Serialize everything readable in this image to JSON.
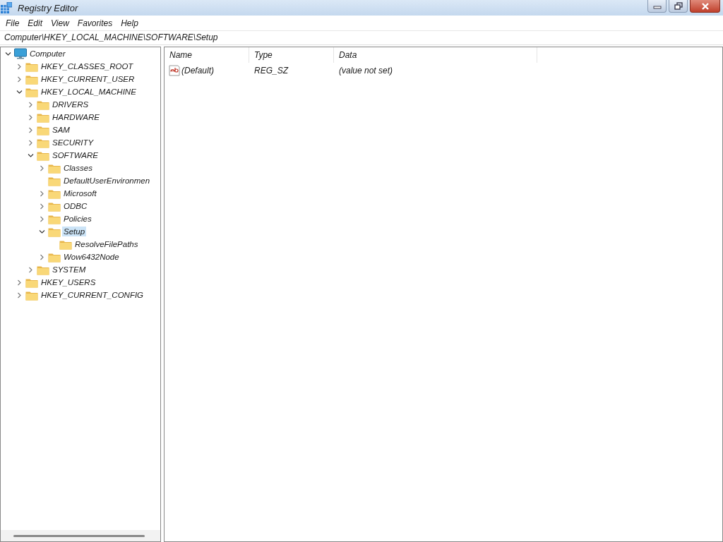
{
  "window": {
    "title": "Registry Editor"
  },
  "menu": [
    "File",
    "Edit",
    "View",
    "Favorites",
    "Help"
  ],
  "address": "Computer\\HKEY_LOCAL_MACHINE\\SOFTWARE\\Setup",
  "tree": [
    {
      "label": "Computer",
      "kind": "computer",
      "expanded": true,
      "selected": false,
      "children": [
        {
          "label": "HKEY_CLASSES_ROOT",
          "kind": "folder",
          "expanded": false,
          "selected": false
        },
        {
          "label": "HKEY_CURRENT_USER",
          "kind": "folder",
          "expanded": false,
          "selected": false
        },
        {
          "label": "HKEY_LOCAL_MACHINE",
          "kind": "folder",
          "expanded": true,
          "selected": false,
          "children": [
            {
              "label": "DRIVERS",
              "kind": "folder",
              "expanded": false,
              "selected": false
            },
            {
              "label": "HARDWARE",
              "kind": "folder",
              "expanded": false,
              "selected": false
            },
            {
              "label": "SAM",
              "kind": "folder",
              "expanded": false,
              "selected": false
            },
            {
              "label": "SECURITY",
              "kind": "folder",
              "expanded": false,
              "selected": false
            },
            {
              "label": "SOFTWARE",
              "kind": "folder",
              "expanded": true,
              "selected": false,
              "children": [
                {
                  "label": "Classes",
                  "kind": "folder",
                  "expanded": false,
                  "selected": false
                },
                {
                  "label": "DefaultUserEnvironmen",
                  "kind": "folder",
                  "selected": false
                },
                {
                  "label": "Microsoft",
                  "kind": "folder",
                  "expanded": false,
                  "selected": false
                },
                {
                  "label": "ODBC",
                  "kind": "folder",
                  "expanded": false,
                  "selected": false
                },
                {
                  "label": "Policies",
                  "kind": "folder",
                  "expanded": false,
                  "selected": false
                },
                {
                  "label": "Setup",
                  "kind": "folder",
                  "expanded": true,
                  "selected": true,
                  "children": [
                    {
                      "label": "ResolveFilePaths",
                      "kind": "folder",
                      "selected": false
                    }
                  ]
                },
                {
                  "label": "Wow6432Node",
                  "kind": "folder",
                  "expanded": false,
                  "selected": false
                }
              ]
            },
            {
              "label": "SYSTEM",
              "kind": "folder",
              "expanded": false,
              "selected": false
            }
          ]
        },
        {
          "label": "HKEY_USERS",
          "kind": "folder",
          "expanded": false,
          "selected": false
        },
        {
          "label": "HKEY_CURRENT_CONFIG",
          "kind": "folder",
          "expanded": false,
          "selected": false
        }
      ]
    }
  ],
  "table": {
    "columns": [
      "Name",
      "Type",
      "Data"
    ],
    "rows": [
      {
        "name": "(Default)",
        "type": "REG_SZ",
        "data": "(value not set)",
        "selected": false
      }
    ]
  }
}
